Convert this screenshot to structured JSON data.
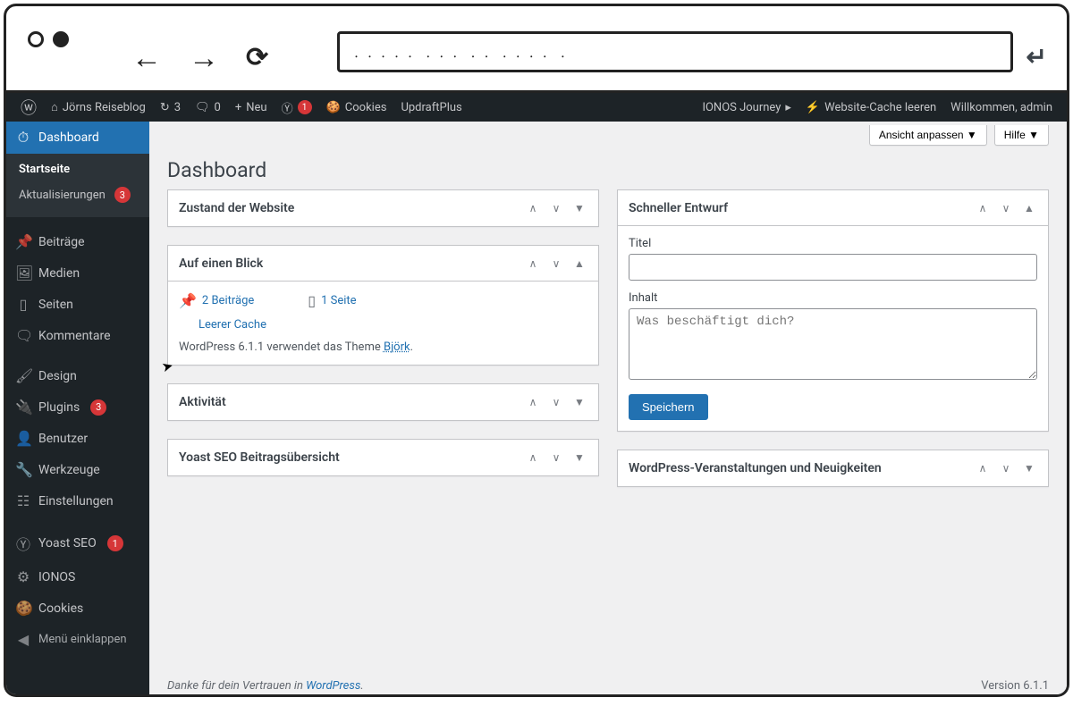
{
  "adminbar": {
    "site_name": "Jörns Reiseblog",
    "updates_count": "3",
    "comments_count": "0",
    "new_label": "Neu",
    "yoast_count": "1",
    "cookies_label": "Cookies",
    "updraft_label": "UpdraftPlus",
    "ionos_journey": "IONOS Journey",
    "cache_clear": "Website-Cache leeren",
    "welcome": "Willkommen, admin"
  },
  "sidebar": {
    "dashboard": "Dashboard",
    "startseite": "Startseite",
    "aktualisierungen": "Aktualisierungen",
    "aktualisierungen_count": "3",
    "beitraege": "Beiträge",
    "medien": "Medien",
    "seiten": "Seiten",
    "kommentare": "Kommentare",
    "design": "Design",
    "plugins": "Plugins",
    "plugins_count": "3",
    "benutzer": "Benutzer",
    "werkzeuge": "Werkzeuge",
    "einstellungen": "Einstellungen",
    "yoast": "Yoast SEO",
    "yoast_count": "1",
    "ionos": "IONOS",
    "cookies": "Cookies",
    "collapse": "Menü einklappen"
  },
  "screen_meta": {
    "customize": "Ansicht anpassen",
    "help": "Hilfe"
  },
  "page_title": "Dashboard",
  "boxes": {
    "site_health": {
      "title": "Zustand der Website"
    },
    "glance": {
      "title": "Auf einen Blick",
      "posts": "2 Beiträge",
      "pages": "1 Seite",
      "empty_cache": "Leerer Cache",
      "wp_text_before": "WordPress 6.1.1 verwendet das Theme ",
      "theme_link": "Björk",
      "wp_text_after": "."
    },
    "activity": {
      "title": "Aktivität"
    },
    "yoast_overview": {
      "title": "Yoast SEO Beitragsübersicht"
    },
    "quick_draft": {
      "title": "Schneller Entwurf",
      "titel_label": "Titel",
      "inhalt_label": "Inhalt",
      "inhalt_placeholder": "Was beschäftigt dich?",
      "save": "Speichern"
    },
    "events": {
      "title": "WordPress-Veranstaltungen und Neuigkeiten"
    }
  },
  "footer": {
    "thanks_before": "Danke für dein Vertrauen in ",
    "thanks_link": "WordPress",
    "thanks_after": ".",
    "version": "Version 6.1.1"
  }
}
